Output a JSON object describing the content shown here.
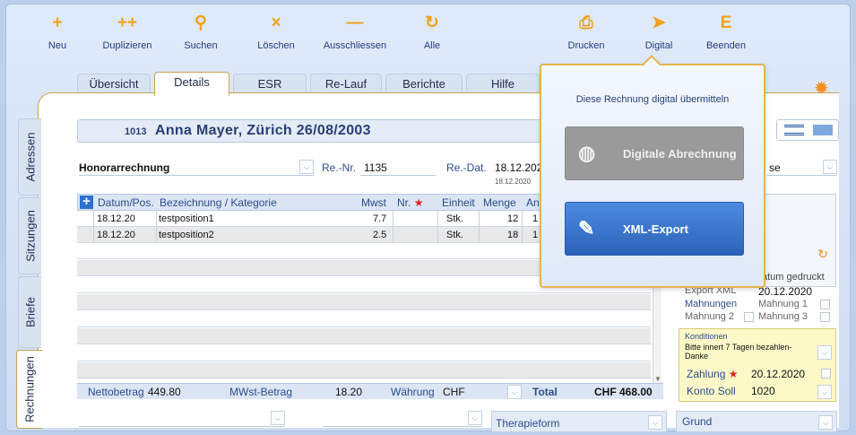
{
  "toolbar": {
    "items": [
      {
        "icon": "+",
        "label": "Neu"
      },
      {
        "icon": "++",
        "label": "Duplizieren"
      },
      {
        "icon": "⚲",
        "label": "Suchen"
      },
      {
        "icon": "×",
        "label": "Löschen"
      },
      {
        "icon": "—",
        "label": "Ausschliessen"
      },
      {
        "icon": "↻",
        "label": "Alle"
      },
      {
        "icon": "⎙",
        "label": "Drucken"
      },
      {
        "icon": "➤",
        "label": "Digital"
      },
      {
        "icon": "E",
        "label": "Beenden"
      }
    ]
  },
  "tabs": [
    "Übersicht",
    "Details",
    "ESR",
    "Re-Lauf",
    "Berichte",
    "Hilfe"
  ],
  "side_tabs": [
    "Adressen",
    "Sitzungen",
    "Briefe",
    "Rechnungen"
  ],
  "header": {
    "id": "1013",
    "name": "Anna Mayer, Zürich   26/08/2003"
  },
  "form": {
    "type": "Honorarrechnung",
    "re_nr_label": "Re.-Nr.",
    "re_nr": "1135",
    "re_dat_label": "Re.-Dat.",
    "re_dat": "18.12.202",
    "re_dat_small": "18.12.2020",
    "right_select": "se"
  },
  "table": {
    "headers": [
      "Datum/Pos.",
      "Bezeichnung / Kategorie",
      "Mwst",
      "Nr.",
      "Einheit",
      "Menge",
      "An"
    ],
    "rows": [
      {
        "date": "18.12.20",
        "desc": "testposition1",
        "mwst": "7.7",
        "nr": "",
        "unit": "Stk.",
        "qty": "12",
        "an": "1"
      },
      {
        "date": "18.12.20",
        "desc": "testposition2",
        "mwst": "2.5",
        "nr": "",
        "unit": "Stk.",
        "qty": "18",
        "an": "1"
      }
    ]
  },
  "footer": {
    "netto_label": "Nettobetrag",
    "netto": "449.80",
    "mwst_label": "MWst-Betrag",
    "mwst": "18.20",
    "waehrung_label": "Währung",
    "waehrung": "CHF",
    "total_label": "Total",
    "total": "CHF 468.00"
  },
  "right": {
    "datum_gedruckt": "atum gedruckt",
    "export_label": "Export XML",
    "export_date": "20.12.2020",
    "mahnungen_label": "Mahnungen",
    "mahnung1": "Mahnung 1",
    "mahnung2": "Mahnung 2",
    "mahnung3": "Mahnung 3",
    "konditionen_label": "Konditionen",
    "konditionen_text": "Bitte innert 7 Tagen bezahlen-Danke",
    "zahlung_label": "Zahlung",
    "zahlung_date": "20.12.2020",
    "konto_label": "Konto Soll",
    "konto": "1020"
  },
  "bottom": {
    "therapieform": "Therapieform",
    "grund": "Grund"
  },
  "popover": {
    "title": "Diese Rechnung digital übermitteln",
    "btn_disabled": "Digitale Abrechnung",
    "btn_primary": "XML-Export"
  },
  "colors": {
    "accent": "#f2a11a",
    "primary": "#2c63b8",
    "tab_border": "#c9a257"
  }
}
